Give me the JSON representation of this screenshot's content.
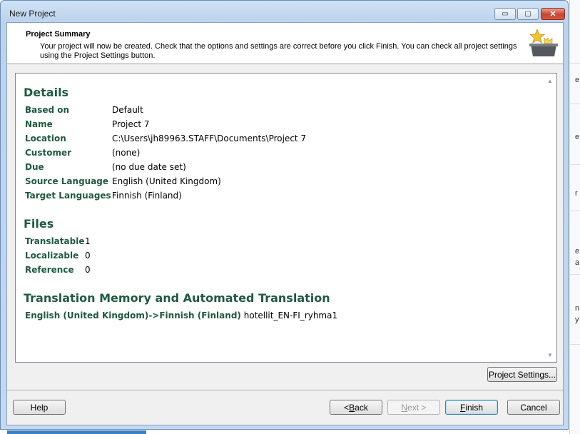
{
  "window": {
    "title": "New Project"
  },
  "titlebar_buttons": {
    "minimize": "▭",
    "maximize": "▢",
    "close": "✕"
  },
  "header": {
    "title": "Project Summary",
    "description": "Your project will now be created. Check that the options and settings are correct before you click Finish. You can check all project settings using the Project Settings button.",
    "icon": "project-wizard-star-icon"
  },
  "details": {
    "heading": "Details",
    "rows": [
      {
        "label": "Based on",
        "value": "Default"
      },
      {
        "label": "Name",
        "value": "Project 7"
      },
      {
        "label": "Location",
        "value": "C:\\Users\\jh89963.STAFF\\Documents\\Project 7"
      },
      {
        "label": "Customer",
        "value": "(none)"
      },
      {
        "label": "Due",
        "value": "(no due date set)"
      },
      {
        "label": "Source Language",
        "value": "English (United Kingdom)"
      },
      {
        "label": "Target Languages",
        "value": "Finnish (Finland)"
      }
    ]
  },
  "files": {
    "heading": "Files",
    "rows": [
      {
        "label": "Translatable",
        "value": "1"
      },
      {
        "label": "Localizable",
        "value": "0"
      },
      {
        "label": "Reference",
        "value": "0"
      }
    ]
  },
  "tm": {
    "heading": "Translation Memory and Automated Translation",
    "pair_label": "English (United Kingdom)->Finnish (Finland)",
    "tm_name": "hotellit_EN-FI_ryhma1"
  },
  "buttons": {
    "project_settings": "Project Settings...",
    "help": "Help",
    "back_prefix": "< ",
    "back_key": "B",
    "back_rest": "ack",
    "next_key": "N",
    "next_rest": "ext >",
    "finish_key": "F",
    "finish_rest": "inish",
    "cancel": "Cancel"
  },
  "background_fragments": [
    "e",
    "e",
    "r",
    "e",
    "a",
    "n",
    "y"
  ],
  "colors": {
    "section_heading": "#1f5a3f",
    "window_frame": "#bcd3ec",
    "close_button": "#c8452f"
  }
}
